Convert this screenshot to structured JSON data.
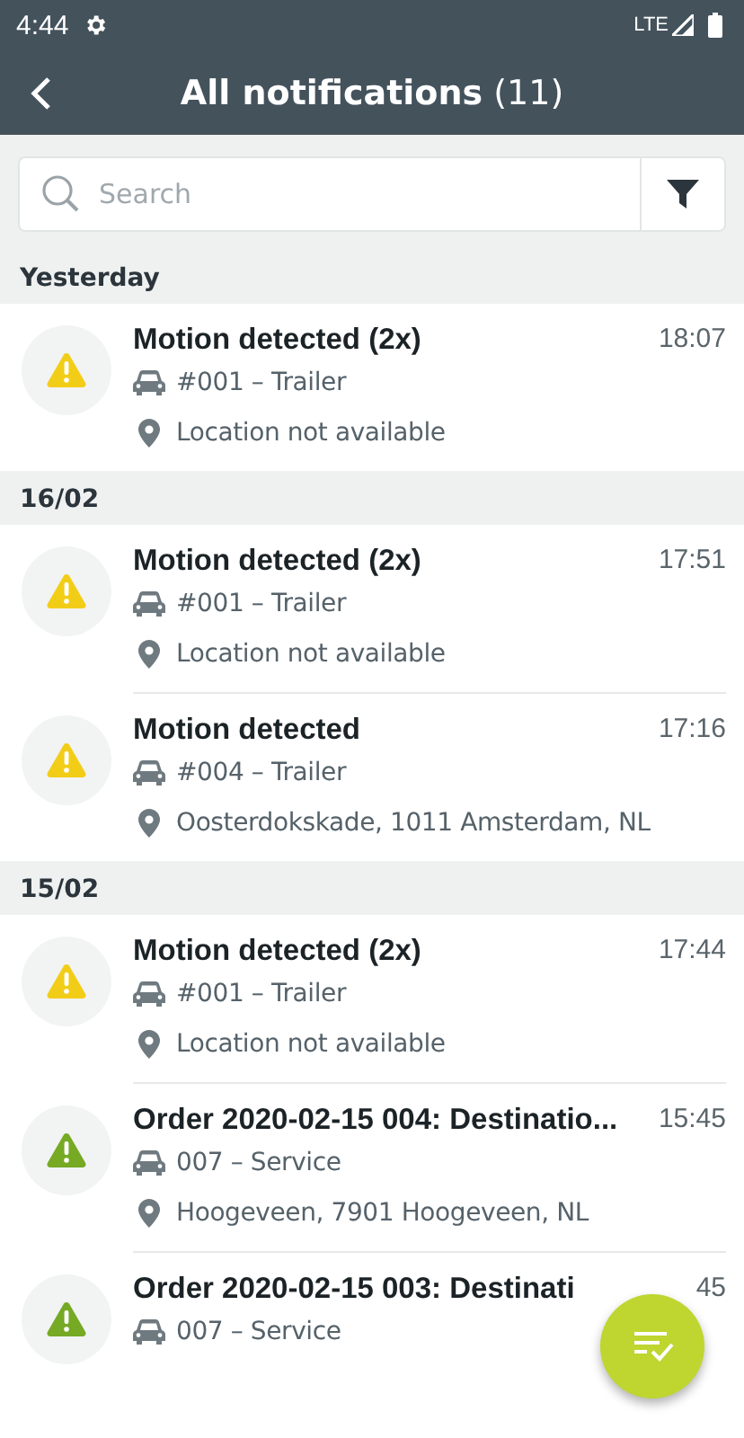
{
  "status_bar": {
    "time": "4:44",
    "network": "LTE"
  },
  "header": {
    "title": "All notifications",
    "count": "(11)"
  },
  "search": {
    "placeholder": "Search"
  },
  "sections": [
    {
      "heading": "Yesterday",
      "items": [
        {
          "title": "Motion detected (2x)",
          "time": "18:07",
          "vehicle": "#001 – Trailer",
          "location": "Location not available",
          "color": "#f2cd18"
        }
      ]
    },
    {
      "heading": "16/02",
      "items": [
        {
          "title": "Motion detected (2x)",
          "time": "17:51",
          "vehicle": "#001 – Trailer",
          "location": "Location not available",
          "color": "#f2cd18"
        },
        {
          "title": "Motion detected",
          "time": "17:16",
          "vehicle": "#004 – Trailer",
          "location": "Oosterdokskade, 1011 Amsterdam, NL",
          "color": "#f2cd18"
        }
      ]
    },
    {
      "heading": "15/02",
      "items": [
        {
          "title": "Motion detected (2x)",
          "time": "17:44",
          "vehicle": "#001 – Trailer",
          "location": "Location not available",
          "color": "#f2cd18"
        },
        {
          "title": "Order 2020-02-15 004: Destinatio...",
          "time": "15:45",
          "vehicle": "007 – Service",
          "location": "Hoogeveen, 7901 Hoogeveen, NL",
          "color": "#76a924"
        },
        {
          "title": "Order 2020-02-15 003: Destinati",
          "time": "45",
          "vehicle": "007 – Service",
          "color": "#76a924"
        }
      ]
    }
  ]
}
